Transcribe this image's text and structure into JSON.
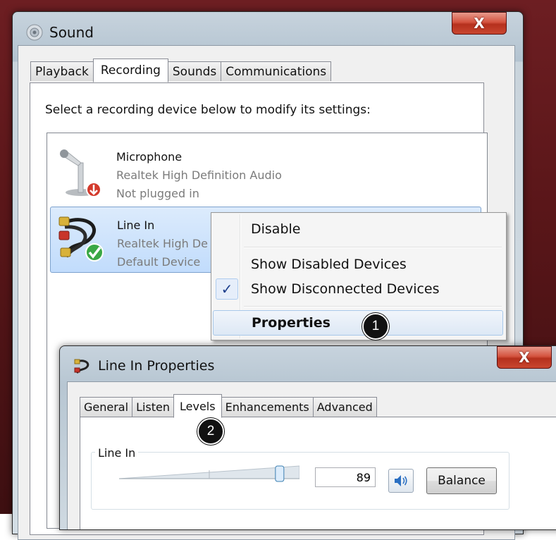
{
  "sound_window": {
    "title": "Sound",
    "close_glyph": "X",
    "tabs": [
      {
        "label": "Playback"
      },
      {
        "label": "Recording",
        "active": true
      },
      {
        "label": "Sounds"
      },
      {
        "label": "Communications"
      }
    ],
    "instruction": "Select a recording device below to modify its settings:",
    "devices": [
      {
        "name": "Microphone",
        "driver": "Realtek High Definition Audio",
        "status": "Not plugged in",
        "icon": "microphone-icon",
        "overlay_icon": "down-arrow-red-icon"
      },
      {
        "name": "Line In",
        "driver": "Realtek High De",
        "status": "Default Device",
        "icon": "line-in-cable-icon",
        "overlay_icon": "green-check-icon",
        "selected": true
      }
    ]
  },
  "context_menu": {
    "items": [
      {
        "label": "Disable"
      },
      {
        "label": "Show Disabled Devices"
      },
      {
        "label": "Show Disconnected Devices",
        "checked": true
      },
      {
        "label": "Properties",
        "bold": true,
        "highlighted": true
      }
    ]
  },
  "step_badges": [
    "1",
    "2"
  ],
  "properties_window": {
    "title": "Line In Properties",
    "close_glyph": "X",
    "tabs": [
      {
        "label": "General"
      },
      {
        "label": "Listen"
      },
      {
        "label": "Levels",
        "active": true
      },
      {
        "label": "Enhancements"
      },
      {
        "label": "Advanced"
      }
    ],
    "levels": {
      "group_label": "Line In",
      "level_value": "89",
      "slider_level": 0.89,
      "mute_icon": "speaker-icon",
      "balance_label": "Balance"
    }
  },
  "colors": {
    "selection": "#c1dcfc",
    "close_button": "#c9462f",
    "desktop": "#5a1619"
  }
}
